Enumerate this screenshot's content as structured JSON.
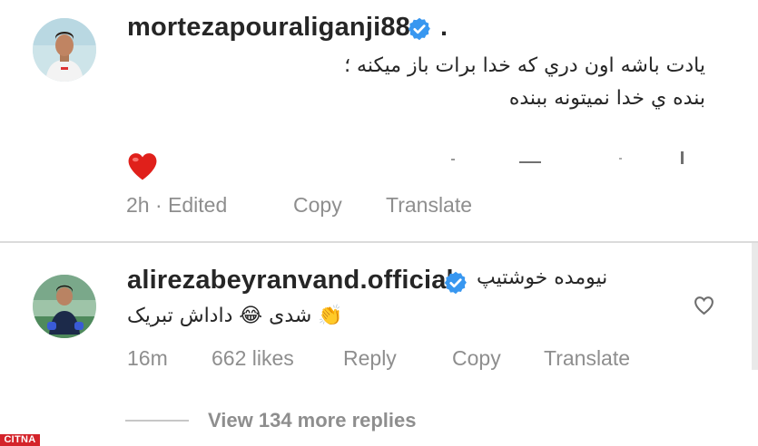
{
  "comment1": {
    "username": "mortezapouraliganji88",
    "trailing": ".",
    "line1": "یادت باشه اون دري که خدا برات باز میکنه ؛",
    "line2": "بنده ي خدا نمیتونه ببنده",
    "reaction_icon": "heart-icon",
    "time": "2h · Edited",
    "copy": "Copy",
    "translate": "Translate"
  },
  "comment2": {
    "username": "alirezabeyranvand.official",
    "text_inline": "نیومده خوشتیپ",
    "text_line2a": "شدی",
    "text_line2b": "داداش تبریک",
    "emoji1": "👏",
    "emoji2": "😂",
    "time": "16m",
    "likes": "662 likes",
    "reply": "Reply",
    "copy": "Copy",
    "translate": "Translate",
    "like_icon": "heart-outline-icon"
  },
  "view_more": "View 134 more replies",
  "watermark": "CITNA",
  "colors": {
    "verified": "#3897f0",
    "heart": "#e0201b",
    "watermark": "#d4232a"
  }
}
